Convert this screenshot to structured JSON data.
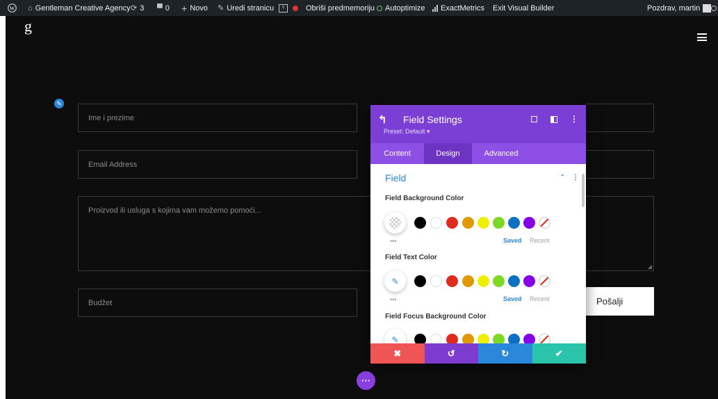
{
  "adminbar": {
    "site_name": "Gentleman Creative Agency",
    "updates_count": "3",
    "comments_count": "0",
    "new_label": "Novo",
    "edit_label": "Uredi stranicu",
    "purge_label": "Obriši predmemoriju",
    "autoptimize_label": "Autoptimize",
    "exactmetrics_label": "ExactMetrics",
    "exit_label": "Exit Visual Builder",
    "greeting": "Pozdrav, martin"
  },
  "site": {
    "logo_text": "g"
  },
  "form": {
    "name_placeholder": "Ime i prezime",
    "email_placeholder": "Email Address",
    "message_placeholder": "Proizvod ili usluga s kojima vam možemo pomoći...",
    "budget_placeholder": "Budžet",
    "submit_label": "Pošalji"
  },
  "panel": {
    "title": "Field Settings",
    "preset": "Preset: Default ▾",
    "tabs": [
      {
        "label": "Content",
        "active": false
      },
      {
        "label": "Design",
        "active": true
      },
      {
        "label": "Advanced",
        "active": false
      }
    ],
    "section_title": "Field",
    "color_groups": [
      {
        "label": "Field Background Color",
        "saved": "Saved",
        "recent": "Recent"
      },
      {
        "label": "Field Text Color",
        "saved": "Saved",
        "recent": "Recent"
      },
      {
        "label": "Field Focus Background Color"
      }
    ],
    "swatches": [
      "#000000",
      "#ffffff",
      "#e02b20",
      "#e09900",
      "#edf000",
      "#7cda24",
      "#0c71c3",
      "#8300e9"
    ],
    "accent": "#7b3fd6",
    "footer_buttons": [
      {
        "name": "discard-button",
        "icon": "close-icon",
        "color": "#ef5555"
      },
      {
        "name": "undo-button",
        "icon": "undo-icon",
        "color": "#7e3bd0"
      },
      {
        "name": "redo-button",
        "icon": "redo-icon",
        "color": "#2b87da"
      },
      {
        "name": "save-button",
        "icon": "check-icon",
        "color": "#29c4a9"
      }
    ]
  }
}
